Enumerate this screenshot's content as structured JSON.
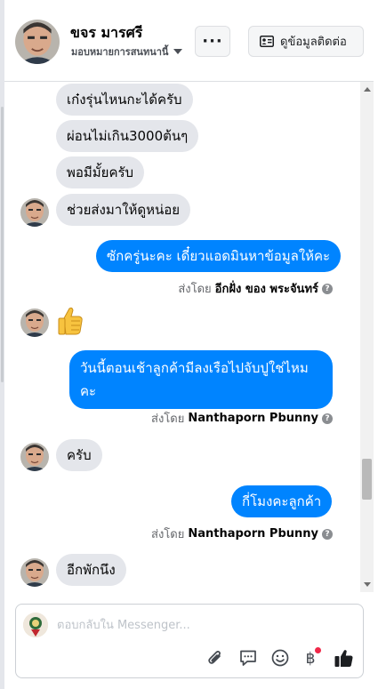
{
  "header": {
    "contact_name": "ขจร มารศรี",
    "assign_label": "มอบหมายการสนทนานี้",
    "more_label": "···",
    "contact_info_label": "ดูข้อมูลติดต่อ"
  },
  "messages": {
    "m1": "เก๋งรุ่นไหนกะได้ครับ",
    "m2": "ผ่อนไม่เกิน3000ต้นๆ",
    "m3": "พอมีมั้ยครับ",
    "m4": "ช่วยส่งมาให้ดูหน่อย",
    "m5": "ซักครู่นะคะ เดี๋ยวแอดมินหาข้อมูลให้คะ",
    "m5_sentby_prefix": "ส่งโดย",
    "m5_sentby_name": "อีกฝั่ง ของ พระจันทร์",
    "m6_emoji": "👍",
    "m7": "วันนี้ตอนเช้าลูกค้ามีลงเรือไปจับปูใช่ไหมคะ",
    "m7_sentby_prefix": "ส่งโดย",
    "m7_sentby_name": "Nanthaporn Pbunny",
    "m8": "ครับ",
    "m9": "กี่โมงคะลูกค้า",
    "m9_sentby_prefix": "ส่งโดย",
    "m9_sentby_name": "Nanthaporn Pbunny",
    "m10": "อีกพักนึง"
  },
  "composer": {
    "placeholder": "ตอบกลับใน Messenger..."
  },
  "colors": {
    "outgoing_bubble": "#0084ff",
    "incoming_bubble": "#e4e6eb",
    "like_icon": "#1c1e21",
    "notification_dot": "#f02849"
  },
  "icons": {
    "more": "more-icon",
    "contact_card": "contact-card-icon",
    "info": "question-icon",
    "attach": "paperclip-icon",
    "saved_replies": "saved-replies-icon",
    "emoji": "emoji-icon",
    "payment": "baht-icon",
    "like": "thumbs-up-icon"
  }
}
